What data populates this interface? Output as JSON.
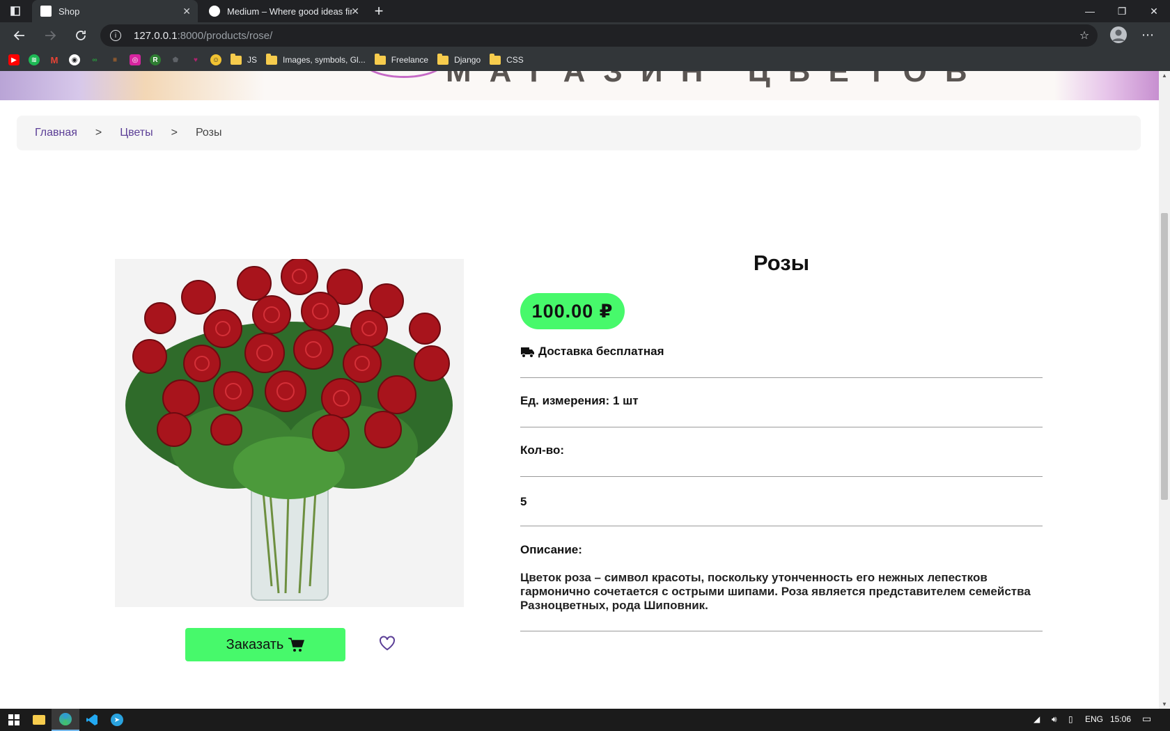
{
  "browser": {
    "tabs": [
      {
        "title": "Shop",
        "active": true
      },
      {
        "title": "Medium – Where good ideas fin",
        "active": false
      }
    ],
    "new_tab": "+",
    "url_host": "127.0.0.1",
    "url_path": ":8000/products/rose/",
    "bookmarks": [
      {
        "label": "",
        "icon": "youtube-icon",
        "color": "#ff0000"
      },
      {
        "label": "",
        "icon": "spotify-icon",
        "color": "#1db954"
      },
      {
        "label": "",
        "icon": "gmail-icon",
        "color": "#ea4335"
      },
      {
        "label": "",
        "icon": "github-icon",
        "color": "#ffffff"
      },
      {
        "label": "",
        "icon": "codewars-icon",
        "color": "#2a9d3f"
      },
      {
        "label": "",
        "icon": "stackoverflow-icon",
        "color": "#f48024"
      },
      {
        "label": "",
        "icon": "instagram-icon",
        "color": "#d6249f"
      },
      {
        "label": "",
        "icon": "r-icon",
        "color": "#2e7d32"
      },
      {
        "label": "",
        "icon": "shield-icon",
        "color": "#5f6368"
      },
      {
        "label": "",
        "icon": "tinder-icon",
        "color": "#b0236e"
      },
      {
        "label": "",
        "icon": "emoji-icon",
        "color": "#f1c232"
      }
    ],
    "folders": [
      "JS",
      "Images, symbols, Gl...",
      "Freelance",
      "Django",
      "CSS"
    ]
  },
  "site": {
    "logo_text": "МАГАЗИН ЦВЕТОВ"
  },
  "breadcrumb": {
    "home": "Главная",
    "category": "Цветы",
    "current": "Розы",
    "sep": ">"
  },
  "product": {
    "title": "Розы",
    "price": "100.00 ₽",
    "delivery": "Доставка бесплатная",
    "unit": "Ед. измерения: 1 шт",
    "qty_label": "Кол-во:",
    "qty_value": "5",
    "desc_label": "Описание:",
    "description": "Цветок роза – символ красоты, поскольку утонченность его нежных лепестков гармонично сочетается с острыми шипами. Роза является представителем семейства Разноцветных, рода Шиповник.",
    "order_button": "Заказать",
    "accent_green": "#47f96b",
    "link_purple": "#5b3e96"
  },
  "taskbar": {
    "lang": "ENG",
    "time": "15:06"
  }
}
